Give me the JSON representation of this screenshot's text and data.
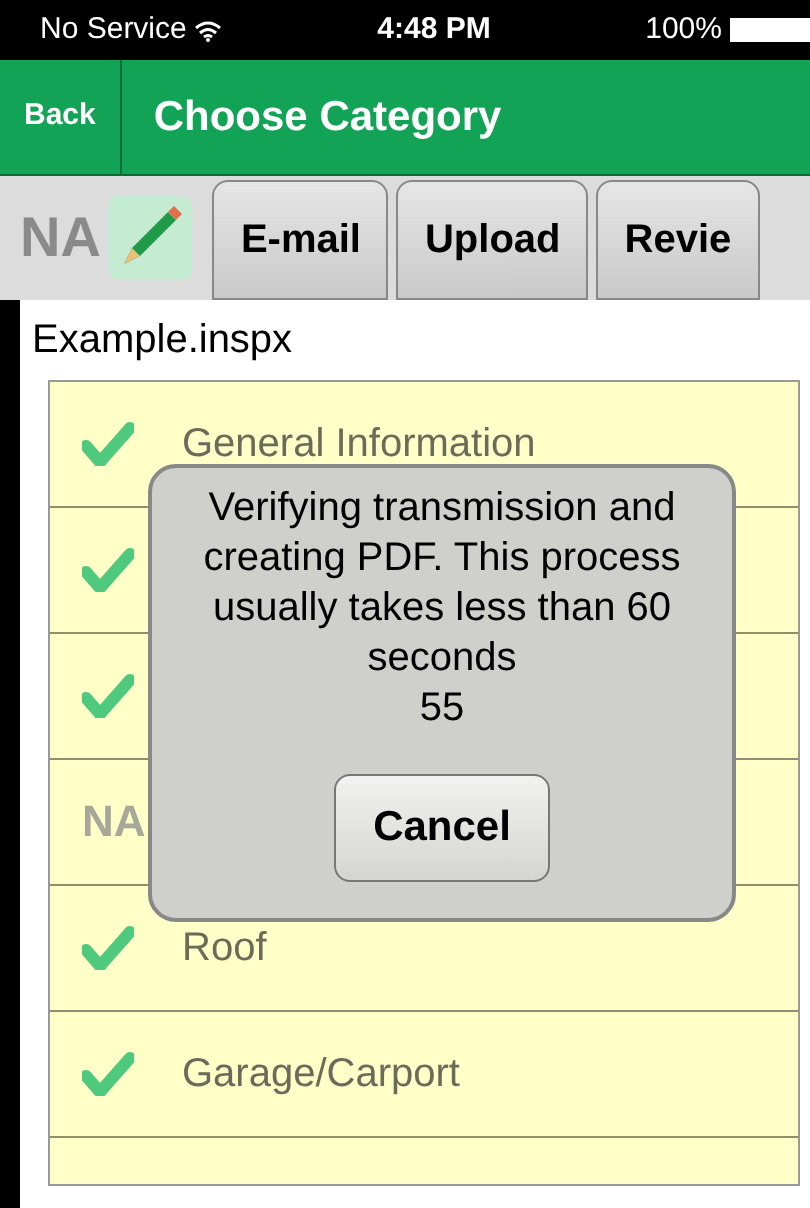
{
  "status_bar": {
    "carrier": "No Service",
    "time": "4:48 PM",
    "battery": "100%"
  },
  "nav_bar": {
    "back": "Back",
    "title": "Choose Category"
  },
  "toolbar": {
    "na": "NA",
    "buttons": [
      "E-mail",
      "Upload",
      "Revie"
    ]
  },
  "file_name": "Example.inspx",
  "categories": [
    {
      "label": "General Information",
      "kind": "check"
    },
    {
      "kind": "check"
    },
    {
      "kind": "check"
    },
    {
      "kind": "na",
      "na": "NA"
    },
    {
      "label": "Roof",
      "kind": "check"
    },
    {
      "label": "Garage/Carport",
      "kind": "check"
    }
  ],
  "dialog": {
    "message": "Verifying transmission and creating PDF. This process usually takes less than 60 seconds",
    "countdown": "55",
    "button": "Cancel"
  }
}
